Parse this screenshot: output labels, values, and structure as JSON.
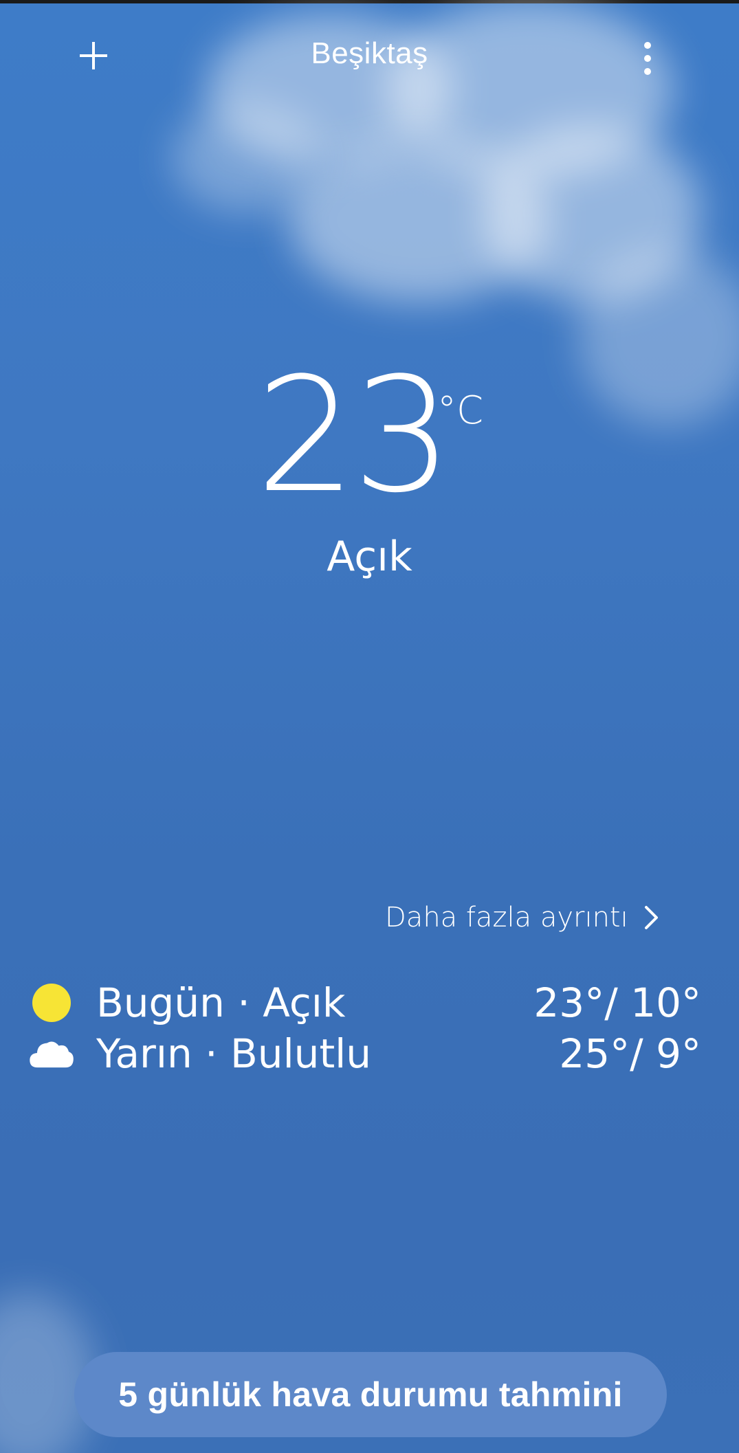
{
  "header": {
    "city": "Beşiktaş",
    "add_icon": "plus-icon",
    "menu_icon": "more-vertical-icon"
  },
  "current": {
    "temperature": "23",
    "unit": "°C",
    "condition": "Açık"
  },
  "details_link": {
    "label": "Daha fazla ayrıntı",
    "icon": "chevron-right-icon"
  },
  "forecast": [
    {
      "label": "Bugün · Açık",
      "range": "23°/ 10°",
      "icon": "sun-icon",
      "icon_color": "#f7e435"
    },
    {
      "label": "Yarın · Bulutlu",
      "range": "25°/ 9°",
      "icon": "cloud-icon",
      "icon_color": "#ffffff"
    }
  ],
  "forecast_button": {
    "label": "5 günlük hava durumu tahmini"
  },
  "colors": {
    "sky": "#3e78c3",
    "button": "#5d88c9",
    "text": "#ffffff"
  }
}
